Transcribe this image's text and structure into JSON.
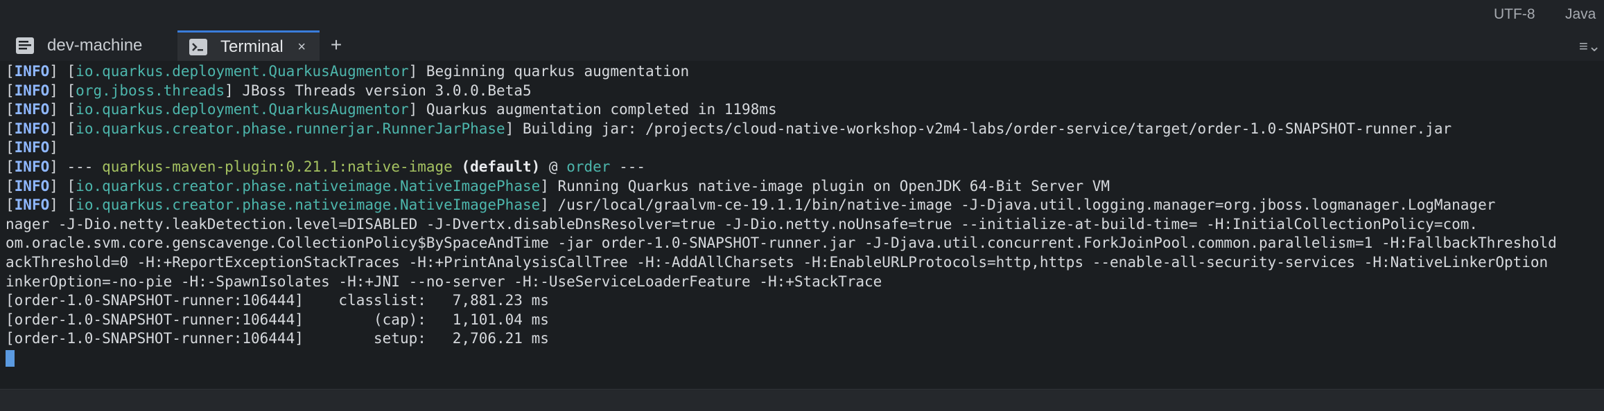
{
  "statusbar": {
    "encoding": "UTF-8",
    "language": "Java"
  },
  "tabs": [
    {
      "label": "dev-machine",
      "icon": "document-icon"
    },
    {
      "label": "Terminal",
      "icon": "terminal-icon",
      "close": "×"
    }
  ],
  "add_tab_label": "+",
  "panel_menu_label": "≡⌄",
  "terminal": {
    "lines": [
      [
        {
          "t": "[",
          "c": ""
        },
        {
          "t": "INFO",
          "c": "info"
        },
        {
          "t": "] [",
          "c": ""
        },
        {
          "t": "io.quarkus.deployment.QuarkusAugmentor",
          "c": "pkg"
        },
        {
          "t": "] Beginning quarkus augmentation",
          "c": ""
        }
      ],
      [
        {
          "t": "[",
          "c": ""
        },
        {
          "t": "INFO",
          "c": "info"
        },
        {
          "t": "] [",
          "c": ""
        },
        {
          "t": "org.jboss.threads",
          "c": "pkg"
        },
        {
          "t": "] JBoss Threads version 3.0.0.Beta5",
          "c": ""
        }
      ],
      [
        {
          "t": "[",
          "c": ""
        },
        {
          "t": "INFO",
          "c": "info"
        },
        {
          "t": "] [",
          "c": ""
        },
        {
          "t": "io.quarkus.deployment.QuarkusAugmentor",
          "c": "pkg"
        },
        {
          "t": "] Quarkus augmentation completed in 1198ms",
          "c": ""
        }
      ],
      [
        {
          "t": "[",
          "c": ""
        },
        {
          "t": "INFO",
          "c": "info"
        },
        {
          "t": "] [",
          "c": ""
        },
        {
          "t": "io.quarkus.creator.phase.runnerjar.RunnerJarPhase",
          "c": "pkg"
        },
        {
          "t": "] Building jar: /projects/cloud-native-workshop-v2m4-labs/order-service/target/order-1.0-SNAPSHOT-runner.jar",
          "c": ""
        }
      ],
      [
        {
          "t": "[",
          "c": ""
        },
        {
          "t": "INFO",
          "c": "info"
        },
        {
          "t": "]",
          "c": ""
        }
      ],
      [
        {
          "t": "[",
          "c": ""
        },
        {
          "t": "INFO",
          "c": "info"
        },
        {
          "t": "] --- ",
          "c": ""
        },
        {
          "t": "quarkus-maven-plugin:0.21.1:native-image",
          "c": "plugin"
        },
        {
          "t": " ",
          "c": ""
        },
        {
          "t": "(default)",
          "c": "bold"
        },
        {
          "t": " @ ",
          "c": ""
        },
        {
          "t": "order",
          "c": "pkg"
        },
        {
          "t": " ---",
          "c": ""
        }
      ],
      [
        {
          "t": "[",
          "c": ""
        },
        {
          "t": "INFO",
          "c": "info"
        },
        {
          "t": "] [",
          "c": ""
        },
        {
          "t": "io.quarkus.creator.phase.nativeimage.NativeImagePhase",
          "c": "pkg"
        },
        {
          "t": "] Running Quarkus native-image plugin on OpenJDK 64-Bit Server VM",
          "c": ""
        }
      ],
      [
        {
          "t": "[",
          "c": ""
        },
        {
          "t": "INFO",
          "c": "info"
        },
        {
          "t": "] [",
          "c": ""
        },
        {
          "t": "io.quarkus.creator.phase.nativeimage.NativeImagePhase",
          "c": "pkg"
        },
        {
          "t": "] /usr/local/graalvm-ce-19.1.1/bin/native-image -J-Djava.util.logging.manager=org.jboss.logmanager.LogManager",
          "c": ""
        }
      ],
      [
        {
          "t": "nager -J-Dio.netty.leakDetection.level=DISABLED -J-Dvertx.disableDnsResolver=true -J-Dio.netty.noUnsafe=true --initialize-at-build-time= -H:InitialCollectionPolicy=com.",
          "c": ""
        }
      ],
      [
        {
          "t": "om.oracle.svm.core.genscavenge.CollectionPolicy$BySpaceAndTime -jar order-1.0-SNAPSHOT-runner.jar -J-Djava.util.concurrent.ForkJoinPool.common.parallelism=1 -H:FallbackThreshold",
          "c": ""
        }
      ],
      [
        {
          "t": "ackThreshold=0 -H:+ReportExceptionStackTraces -H:+PrintAnalysisCallTree -H:-AddAllCharsets -H:EnableURLProtocols=http,https --enable-all-security-services -H:NativeLinkerOption",
          "c": ""
        }
      ],
      [
        {
          "t": "inkerOption=-no-pie -H:-SpawnIsolates -H:+JNI --no-server -H:-UseServiceLoaderFeature -H:+StackTrace",
          "c": ""
        }
      ],
      [
        {
          "t": "[order-1.0-SNAPSHOT-runner:106444]    classlist:   7,881.23 ms",
          "c": ""
        }
      ],
      [
        {
          "t": "[order-1.0-SNAPSHOT-runner:106444]        (cap):   1,101.04 ms",
          "c": ""
        }
      ],
      [
        {
          "t": "[order-1.0-SNAPSHOT-runner:106444]        setup:   2,706.21 ms",
          "c": ""
        }
      ]
    ]
  }
}
